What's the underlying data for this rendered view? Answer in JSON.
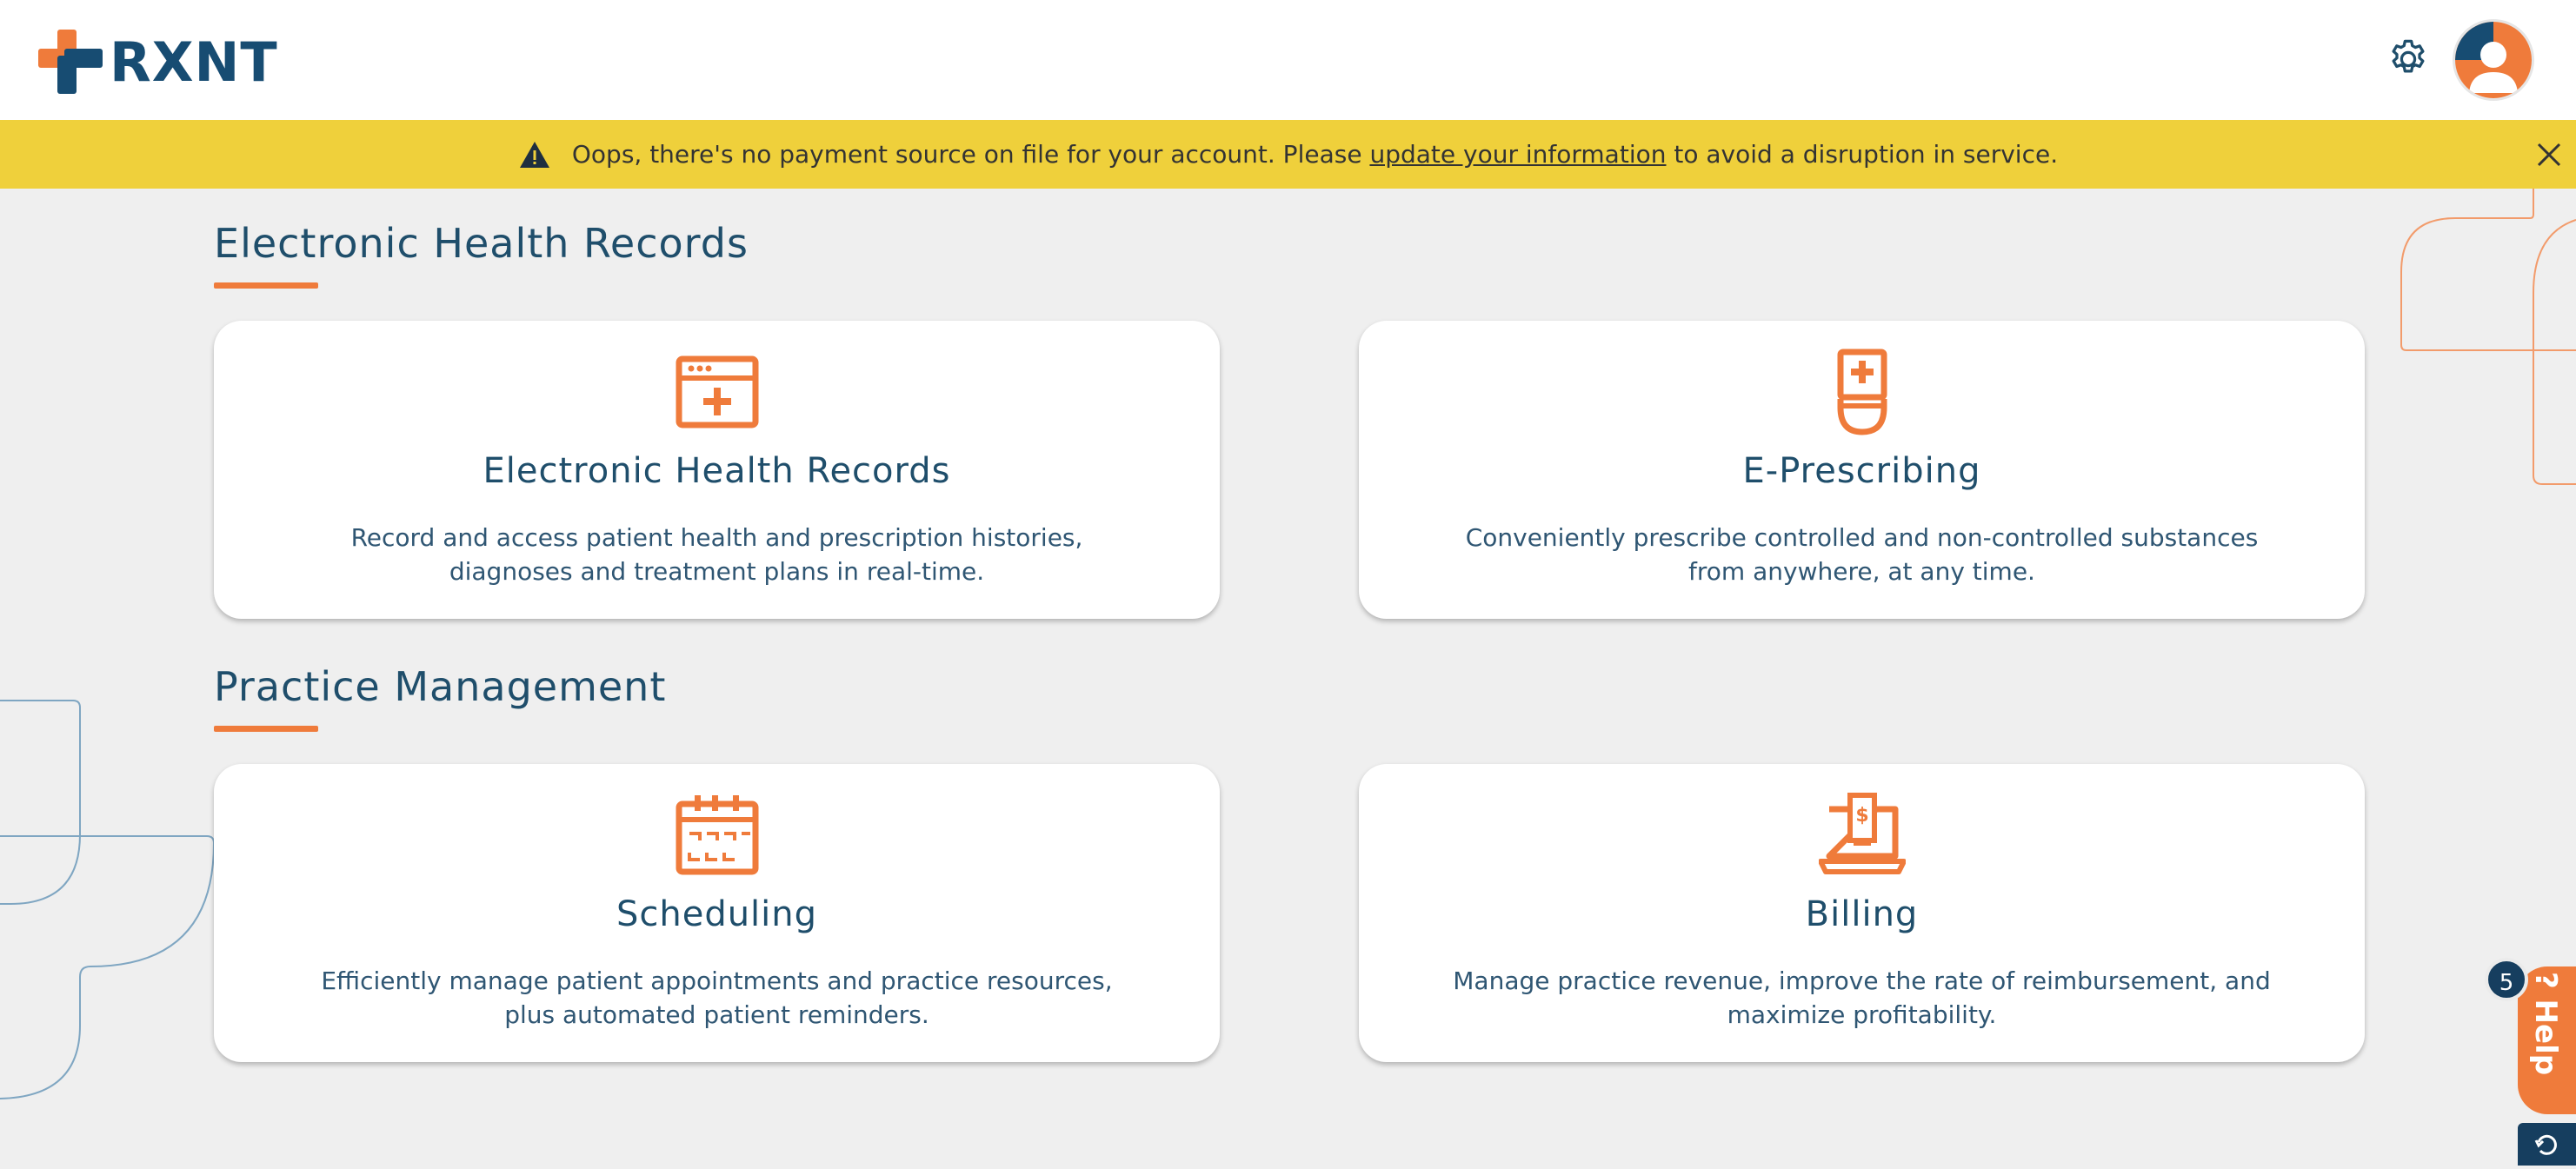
{
  "header": {
    "logo_text": "RXNT",
    "settings_icon": "gear-icon",
    "avatar_icon": "user-avatar"
  },
  "banner": {
    "text_before": "Oops, there's no payment source on file for your account. Please ",
    "link_text": "update your information",
    "text_after": " to avoid a disruption in service.",
    "background": "#efd03b"
  },
  "sections": [
    {
      "title": "Electronic Health Records",
      "cards": [
        {
          "title": "Electronic Health Records",
          "description": "Record and access patient health and prescription histories, diagnoses and treatment plans in real-time.",
          "icon": "ehr-browser-plus-icon"
        },
        {
          "title": "E-Prescribing",
          "description": "Conveniently prescribe controlled and non-controlled substances from anywhere, at any time.",
          "icon": "prescription-bottle-icon"
        }
      ]
    },
    {
      "title": "Practice Management",
      "cards": [
        {
          "title": "Scheduling",
          "description": "Efficiently manage patient appointments and practice resources, plus automated patient reminders.",
          "icon": "calendar-icon"
        },
        {
          "title": "Billing",
          "description": "Manage practice revenue, improve the rate of reimbursement, and maximize profitability.",
          "icon": "laptop-invoice-icon"
        }
      ]
    }
  ],
  "help": {
    "label": "? Help",
    "badge_count": "5"
  },
  "colors": {
    "accent": "#ef7b3b",
    "brand": "#174c72",
    "background": "#efefef"
  }
}
